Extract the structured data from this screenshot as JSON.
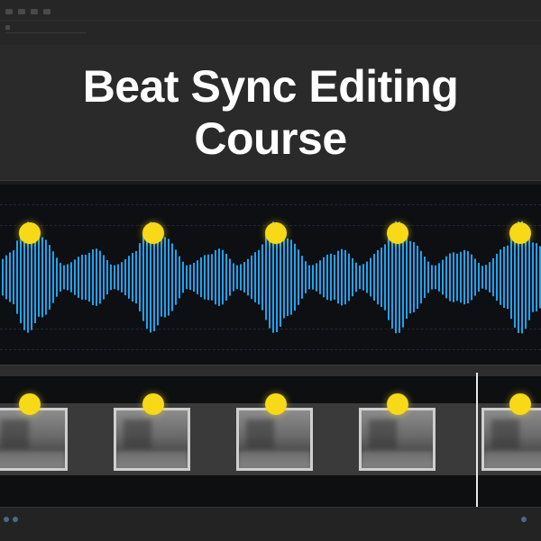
{
  "title": {
    "line1": "Beat Sync Editing",
    "line2": "Course"
  },
  "colors": {
    "waveform": "#1fa3f0",
    "beat_marker": "#f7d917",
    "background": "#1b1b1b",
    "playhead": "#e8e8e8"
  },
  "audio_track": {
    "beat_marker_count": 5
  },
  "video_track": {
    "thumbnail_count": 5,
    "beat_marker_count": 5
  }
}
